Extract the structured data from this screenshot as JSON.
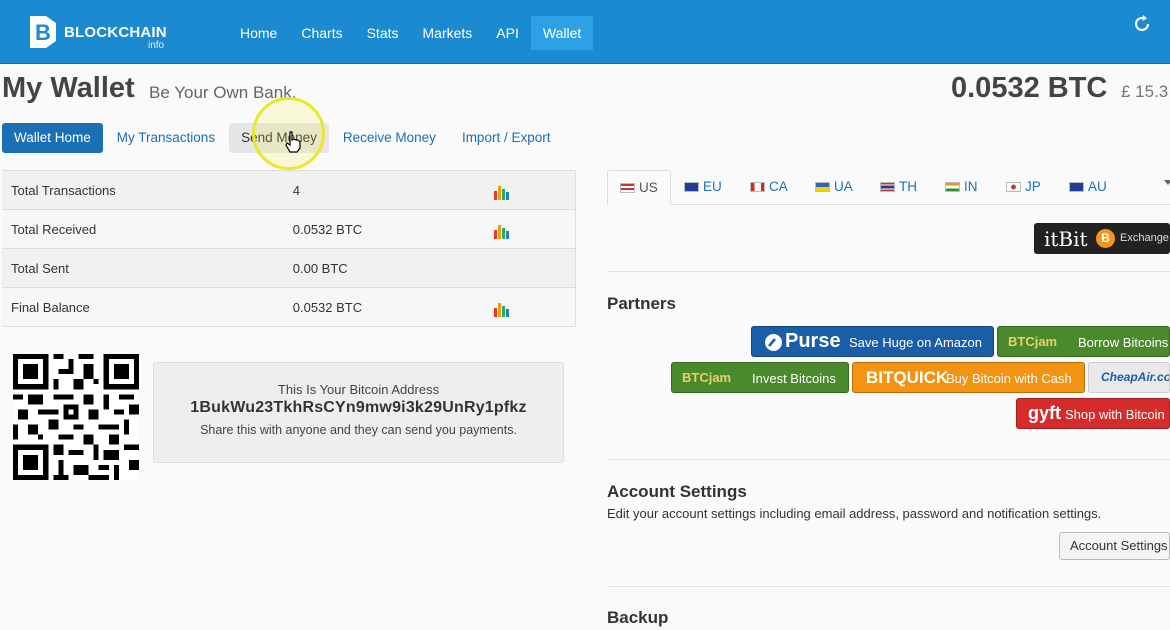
{
  "topnav": {
    "logo_word": "BLOCKCHAIN",
    "logo_sub": "info",
    "links": [
      "Home",
      "Charts",
      "Stats",
      "Markets",
      "API",
      "Wallet"
    ],
    "active": "Wallet"
  },
  "header": {
    "title": "My Wallet",
    "subtitle": "Be Your Own Bank.",
    "balance": "0.0532 BTC",
    "fiat": "£ 15.3"
  },
  "wallet_tabs": [
    "Wallet Home",
    "My Transactions",
    "Send Money",
    "Receive Money",
    "Import / Export"
  ],
  "stats": [
    {
      "label": "Total Transactions",
      "value": "4",
      "chart_icon": true
    },
    {
      "label": "Total Received",
      "value": "0.0532 BTC",
      "chart_icon": true
    },
    {
      "label": "Total Sent",
      "value": "0.00 BTC",
      "chart_icon": false
    },
    {
      "label": "Final Balance",
      "value": "0.0532 BTC",
      "chart_icon": true
    }
  ],
  "address": {
    "heading": "This Is Your Bitcoin Address",
    "value": "1BukWu23TkhRsCYn9mw9i3k29UnRy1pfkz",
    "hint": "Share this with anyone and they can send you payments."
  },
  "country_tabs": [
    "US",
    "EU",
    "CA",
    "UA",
    "TH",
    "IN",
    "JP",
    "AU"
  ],
  "itbit": {
    "brand": "itBit",
    "coin": "B",
    "tag": "Exchange"
  },
  "partners": {
    "title": "Partners",
    "purse": {
      "brand": "Purse",
      "text": "Save Huge on Amazon"
    },
    "btcjam1": {
      "brand": "BTCjam",
      "text": "Borrow Bitcoins"
    },
    "btcjam2": {
      "brand": "BTCjam",
      "text": "Invest Bitcoins"
    },
    "bitquick": {
      "brand": "BITQUICK",
      "text": "Buy Bitcoin with Cash"
    },
    "cheapair": {
      "brand": "CheapAir.com"
    },
    "gyft": {
      "brand": "gyft",
      "text": "Shop with Bitcoin"
    }
  },
  "account_settings": {
    "title": "Account Settings",
    "desc": "Edit your account settings including email address, password and notification settings.",
    "button": "Account Settings"
  },
  "backup": {
    "title": "Backup"
  },
  "colors": {
    "nav_bg": "#1b8ad0",
    "link": "#1b70b5",
    "highlight": "#e8e82a"
  }
}
